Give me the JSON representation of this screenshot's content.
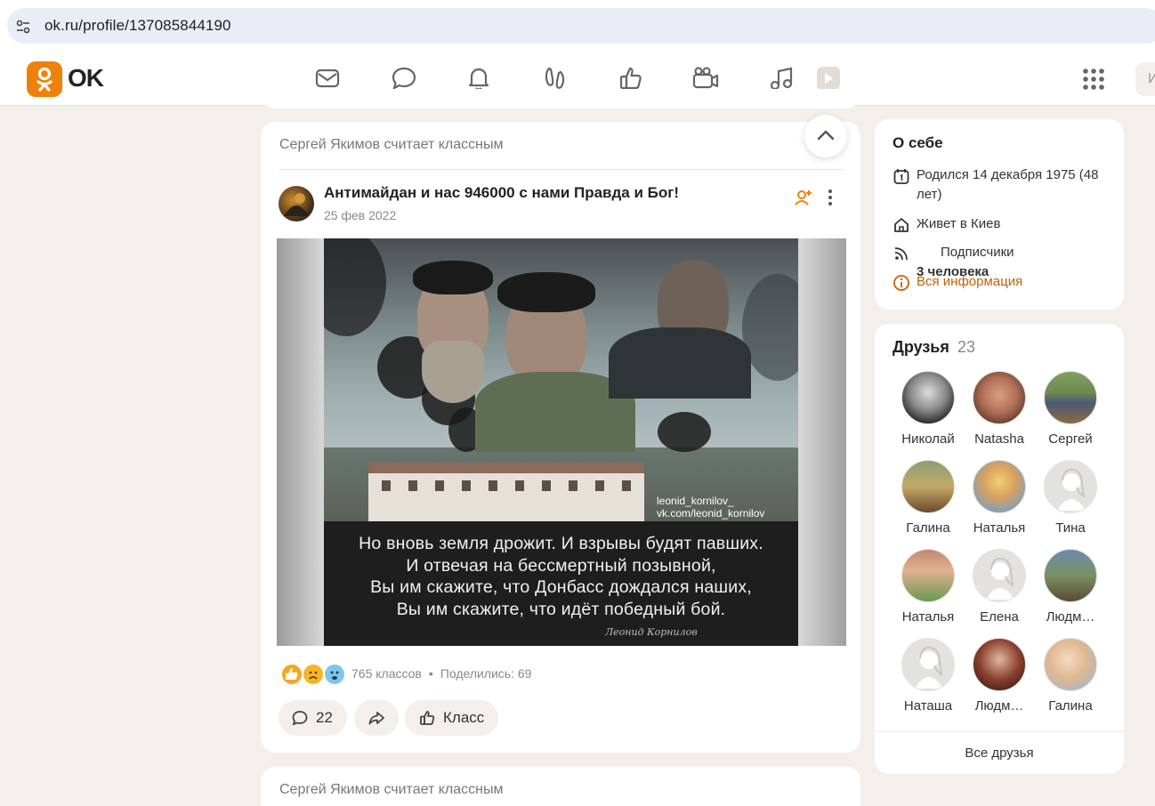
{
  "browser": {
    "url": "ok.ru/profile/137085844190"
  },
  "header": {
    "logo_text": "OK",
    "search_hint": "И",
    "nav_icons": [
      "mail-icon",
      "chat-icon",
      "bell-icon",
      "guests-icon",
      "like-icon",
      "video-icon",
      "music-icon",
      "games-icon"
    ]
  },
  "post": {
    "liked_by": "Сергей Якимов считает классным",
    "author": "Антимайдан и нас 946000 с нами Правда и Бог!",
    "date": "25 фев 2022",
    "image_caption_lines": [
      "Но вновь земля дрожит. И взрывы будят павших.",
      "И отвечая на бессмертный позывной,",
      "Вы им скажите, что Донбасс дождался наших,",
      "Вы им скажите, что идёт победный бой."
    ],
    "image_watermark": "leonid_kornilov_",
    "image_watermark_2": "vk.com/leonid_kornilov",
    "image_signature": "Леонид Корнилов",
    "reactions_count": "765 классов",
    "separator": "•",
    "shares": "Поделились: 69",
    "comments_count": "22",
    "class_label": "Класс"
  },
  "next_post": {
    "liked_by": "Сергей Якимов считает классным"
  },
  "about": {
    "title": "О себе",
    "birth": "Родился 14 декабря 1975 (48 лет)",
    "lives": "Живет в Киев",
    "subscribers_label": "Подписчики",
    "subscribers_value": "3 человека",
    "all_info": "Вся информация"
  },
  "friends": {
    "title": "Друзья",
    "count": "23",
    "list": [
      {
        "name": "Николай"
      },
      {
        "name": "Natasha"
      },
      {
        "name": "Сергей"
      },
      {
        "name": "Галина"
      },
      {
        "name": "Наталья"
      },
      {
        "name": "Тина"
      },
      {
        "name": "Наталья"
      },
      {
        "name": "Елена"
      },
      {
        "name": "Людм…"
      },
      {
        "name": "Наташа"
      },
      {
        "name": "Людм…"
      },
      {
        "name": "Галина"
      }
    ],
    "all_label": "Все друзья"
  },
  "colors": {
    "brand": "#ee8208",
    "link": "#c26107",
    "page_bg": "#f2efec"
  }
}
